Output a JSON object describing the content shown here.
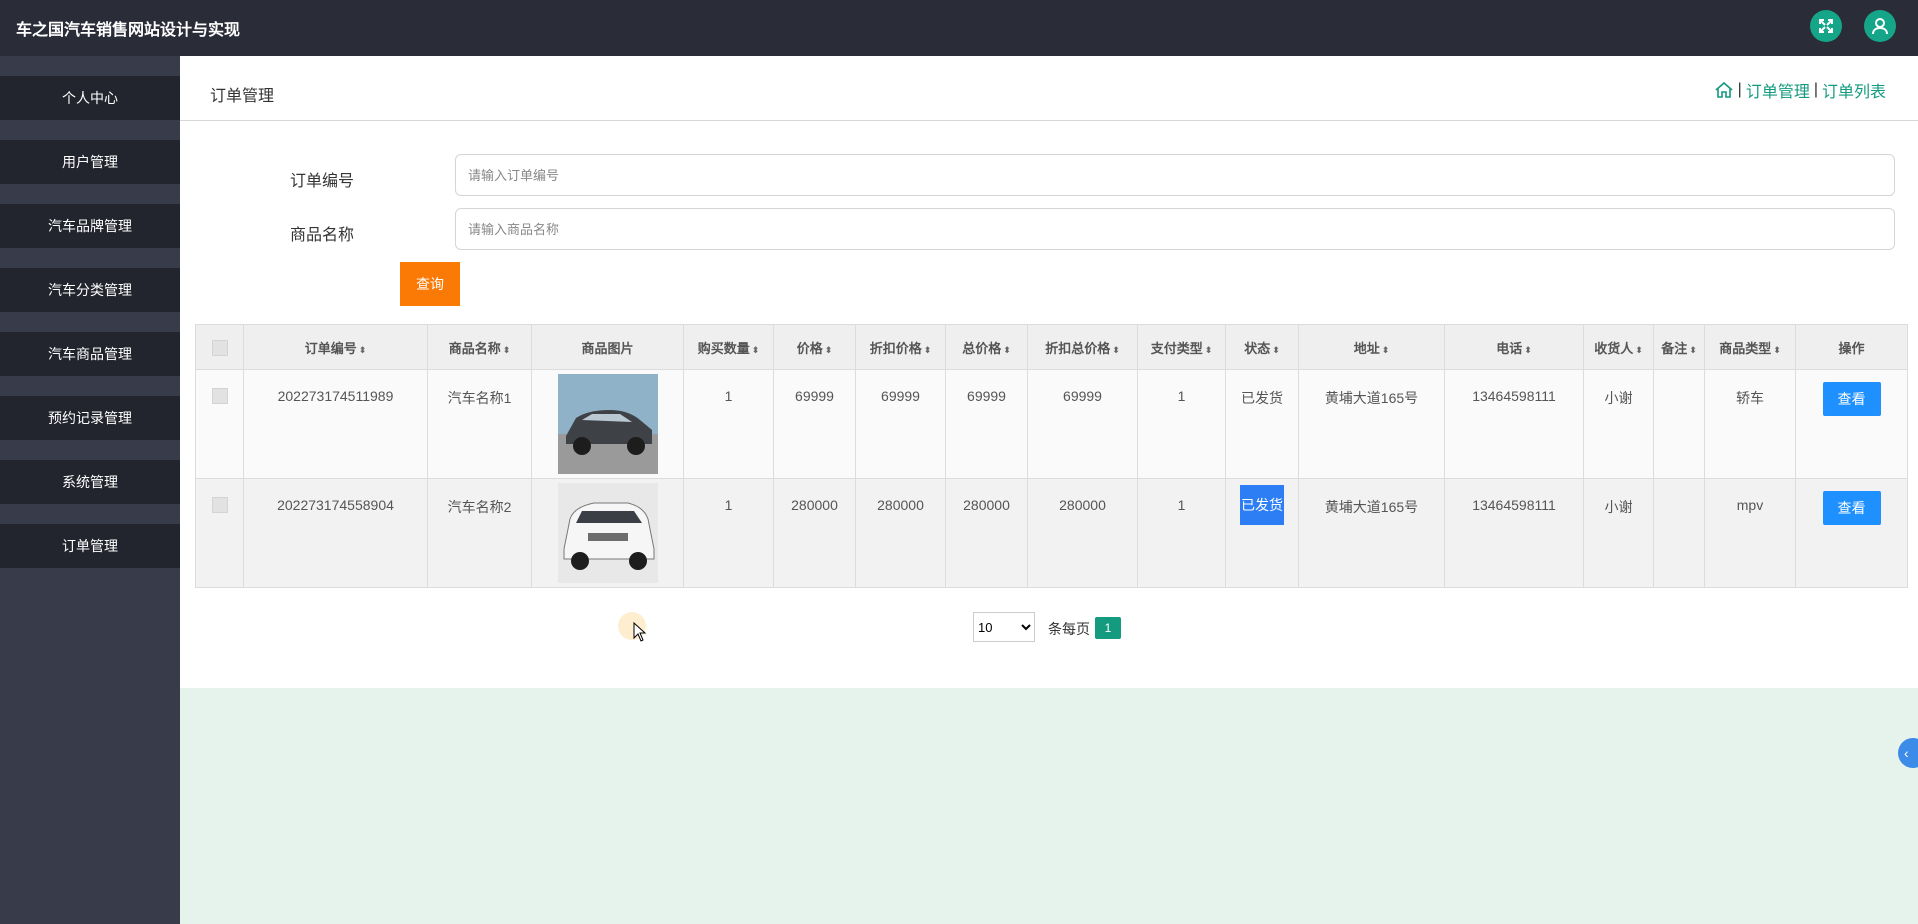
{
  "app": {
    "title": "车之国汽车销售网站设计与实现"
  },
  "icons": {
    "fullscreen": "expand-icon",
    "user": "user-icon",
    "home": "home-icon"
  },
  "colors": {
    "accent": "#139a7f",
    "topbar": "#2a2c37",
    "sidebar": "#383b4a",
    "query": "#fa7a05",
    "view": "#1e90ff"
  },
  "sidebar": {
    "items": [
      {
        "label": "个人中心"
      },
      {
        "label": "用户管理"
      },
      {
        "label": "汽车品牌管理"
      },
      {
        "label": "汽车分类管理"
      },
      {
        "label": "汽车商品管理"
      },
      {
        "label": "预约记录管理"
      },
      {
        "label": "系统管理"
      },
      {
        "label": "订单管理"
      }
    ]
  },
  "header": {
    "heading": "订单管理",
    "breadcrumb": {
      "sep": "|",
      "level1": "订单管理",
      "level2": "订单列表"
    }
  },
  "search": {
    "order_label": "订单编号",
    "order_placeholder": "请输入订单编号",
    "product_label": "商品名称",
    "product_placeholder": "请输入商品名称",
    "query_label": "查询"
  },
  "table": {
    "columns": [
      "订单编号",
      "商品名称",
      "商品图片",
      "购买数量",
      "价格",
      "折扣价格",
      "总价格",
      "折扣总价格",
      "支付类型",
      "状态",
      "地址",
      "电话",
      "收货人",
      "备注",
      "商品类型",
      "操作"
    ],
    "rows": [
      {
        "order_no": "202273174511989",
        "name": "汽车名称1",
        "qty": "1",
        "price": "69999",
        "discount_price": "69999",
        "total": "69999",
        "discount_total": "69999",
        "pay_type": "1",
        "status": "已发货",
        "address": "黄埔大道165号",
        "phone": "13464598111",
        "receiver": "小谢",
        "note": "",
        "type": "轿车",
        "action": "查看"
      },
      {
        "order_no": "202273174558904",
        "name": "汽车名称2",
        "qty": "1",
        "price": "280000",
        "discount_price": "280000",
        "total": "280000",
        "discount_total": "280000",
        "pay_type": "1",
        "status": "已发货",
        "address": "黄埔大道165号",
        "phone": "13464598111",
        "receiver": "小谢",
        "note": "",
        "type": "mpv",
        "action": "查看"
      }
    ]
  },
  "pagination": {
    "page_size": "10",
    "per_page_label": "条每页",
    "current_page": "1"
  }
}
